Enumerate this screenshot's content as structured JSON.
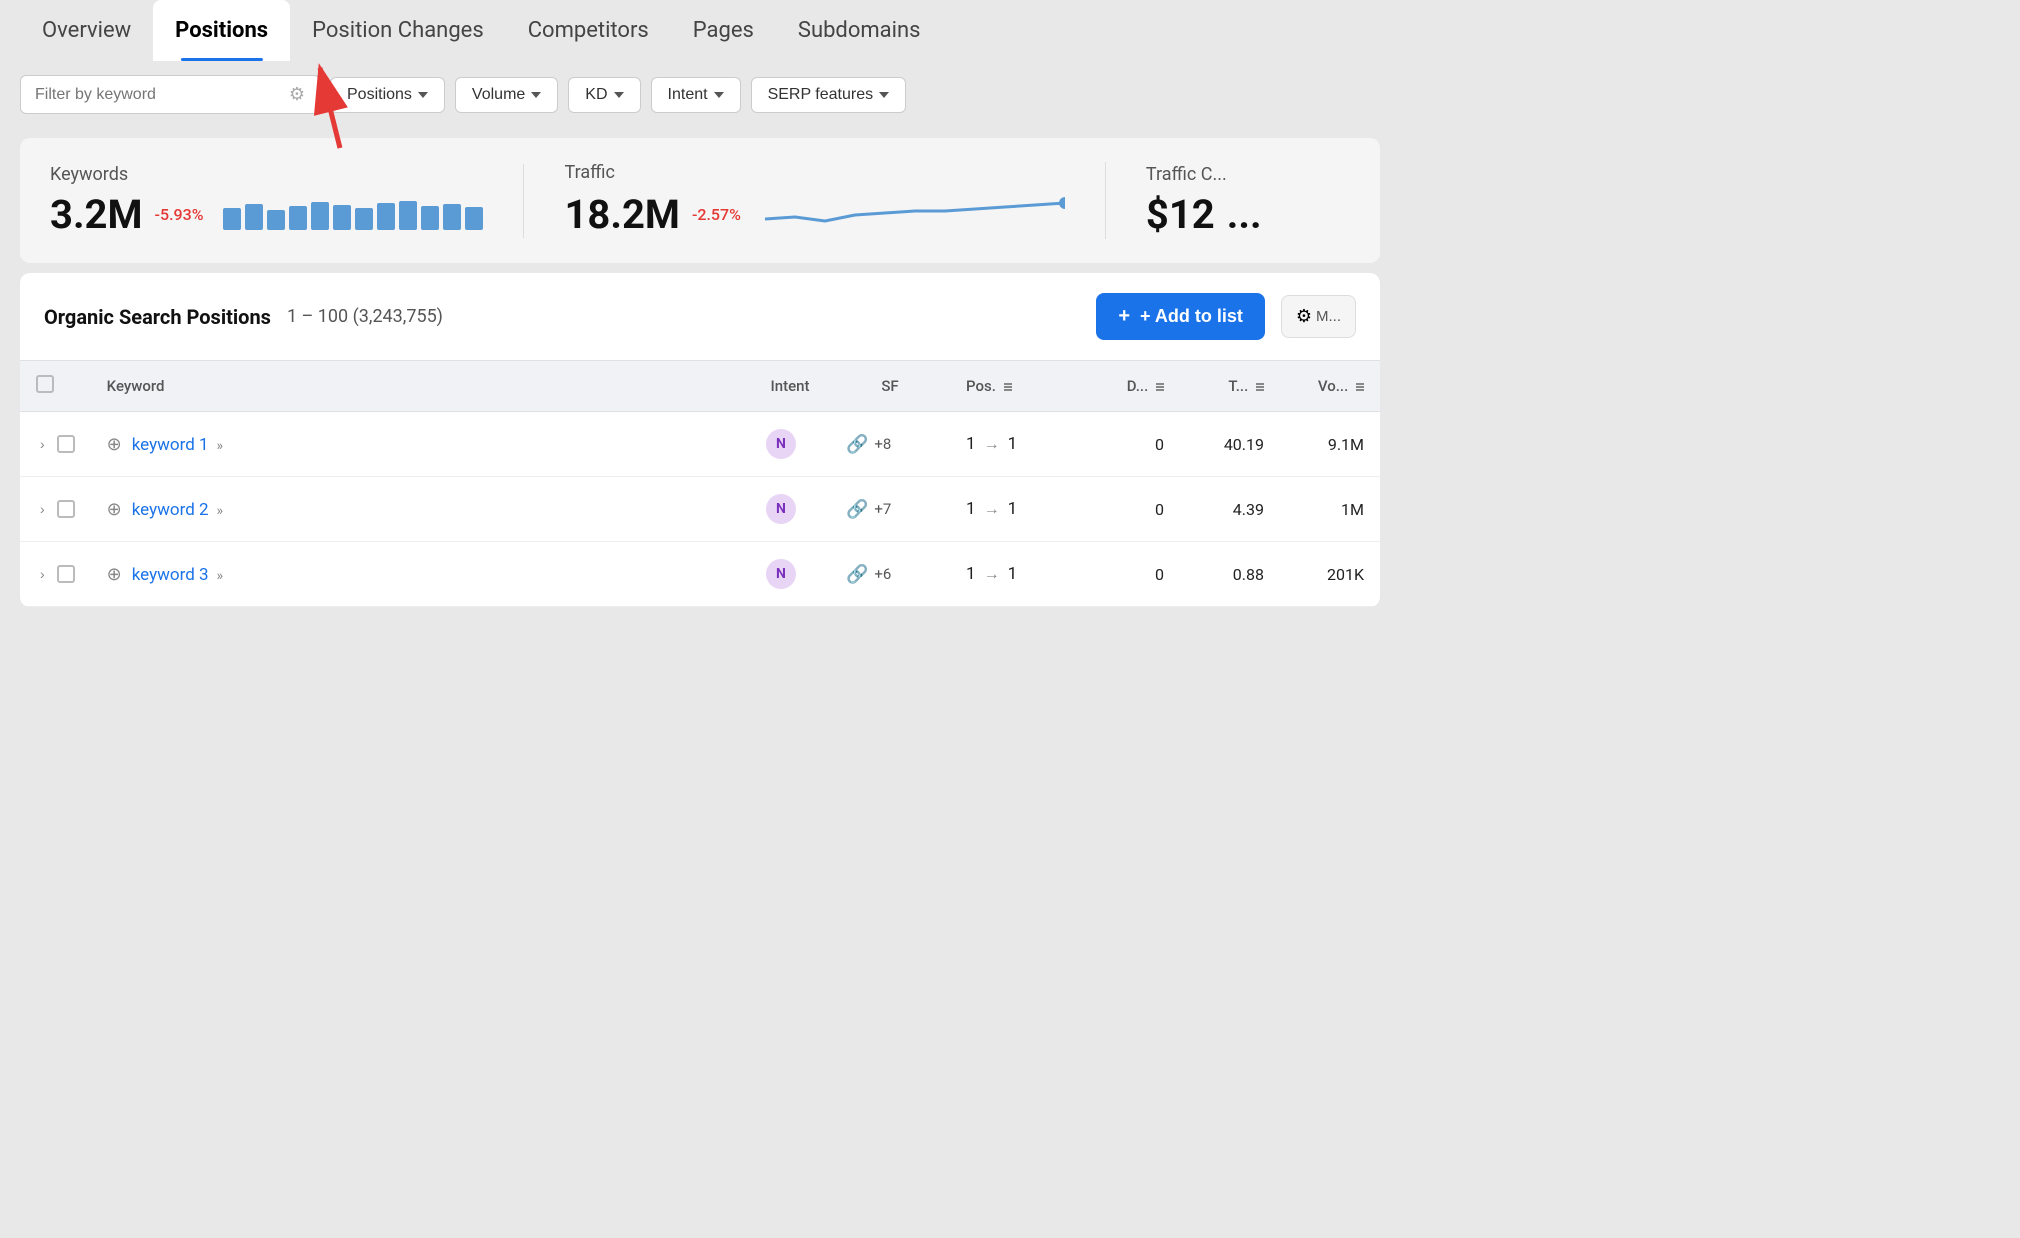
{
  "nav": {
    "tabs": [
      {
        "id": "overview",
        "label": "Overview",
        "active": false
      },
      {
        "id": "positions",
        "label": "Positions",
        "active": true
      },
      {
        "id": "position-changes",
        "label": "Position Changes",
        "active": false
      },
      {
        "id": "competitors",
        "label": "Competitors",
        "active": false
      },
      {
        "id": "pages",
        "label": "Pages",
        "active": false
      },
      {
        "id": "subdomains",
        "label": "Subdomains",
        "active": false
      }
    ]
  },
  "filters": {
    "keyword_placeholder": "Filter by keyword",
    "buttons": [
      {
        "id": "positions",
        "label": "Positions"
      },
      {
        "id": "volume",
        "label": "Volume"
      },
      {
        "id": "kd",
        "label": "KD"
      },
      {
        "id": "intent",
        "label": "Intent"
      },
      {
        "id": "serp",
        "label": "SERP features"
      }
    ]
  },
  "stats": {
    "keywords": {
      "label": "Keywords",
      "value": "3.2M",
      "change": "-5.93%",
      "bars": [
        28,
        32,
        26,
        30,
        34,
        31,
        28,
        33,
        35,
        30,
        32,
        29
      ]
    },
    "traffic": {
      "label": "Traffic",
      "value": "18.2M",
      "change": "-2.57%"
    },
    "traffic_cost": {
      "label": "Traffic C...",
      "value": "$12"
    }
  },
  "table": {
    "title": "Organic Search Positions",
    "range": "1 – 100 (3,243,755)",
    "add_to_list_label": "+ Add to list",
    "columns": [
      {
        "id": "keyword",
        "label": "Keyword"
      },
      {
        "id": "intent",
        "label": "Intent"
      },
      {
        "id": "sf",
        "label": "SF"
      },
      {
        "id": "pos",
        "label": "Pos."
      },
      {
        "id": "d",
        "label": "D..."
      },
      {
        "id": "t",
        "label": "T..."
      },
      {
        "id": "vo",
        "label": "Vo..."
      }
    ],
    "rows": [
      {
        "keyword": "keyword 1",
        "intent": "N",
        "sf_icon": "🔗",
        "sf_count": "+8",
        "pos_from": "1",
        "pos_to": "1",
        "d": "0",
        "t": "40.19",
        "vo": "9.1M"
      },
      {
        "keyword": "keyword 2",
        "intent": "N",
        "sf_icon": "🔗",
        "sf_count": "+7",
        "pos_from": "1",
        "pos_to": "1",
        "d": "0",
        "t": "4.39",
        "vo": "1M"
      },
      {
        "keyword": "keyword 3",
        "intent": "N",
        "sf_icon": "🔗",
        "sf_count": "+6",
        "pos_from": "1",
        "pos_to": "1",
        "d": "0",
        "t": "0.88",
        "vo": "201K"
      }
    ]
  }
}
